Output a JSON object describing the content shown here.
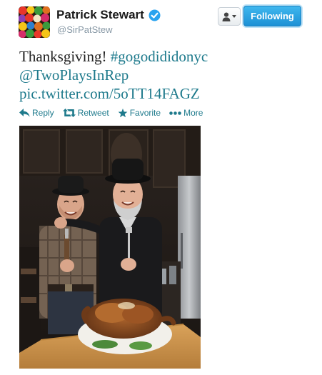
{
  "account": {
    "name": "Patrick Stewart",
    "handle": "@SirPatStew"
  },
  "buttons": {
    "follow_label": "Following"
  },
  "tweet": {
    "text_plain": "Thanksgiving! ",
    "hashtag": "#gogodididonyc",
    "mention": "@TwoPlaysInRep",
    "link": "pic.twitter.com/5oTT14FAGZ"
  },
  "actions": {
    "reply": "Reply",
    "retweet": "Retweet",
    "favorite": "Favorite",
    "more": "More"
  },
  "colors": {
    "link": "#1e7a8c",
    "follow_button": "#1d91d5",
    "verified": "#2aa3ef"
  },
  "icons": {
    "verified": "verified-badge-icon",
    "user_menu": "user-icon",
    "reply": "reply-arrow-icon",
    "retweet": "retweet-icon",
    "favorite": "star-icon",
    "more": "ellipsis-icon"
  }
}
